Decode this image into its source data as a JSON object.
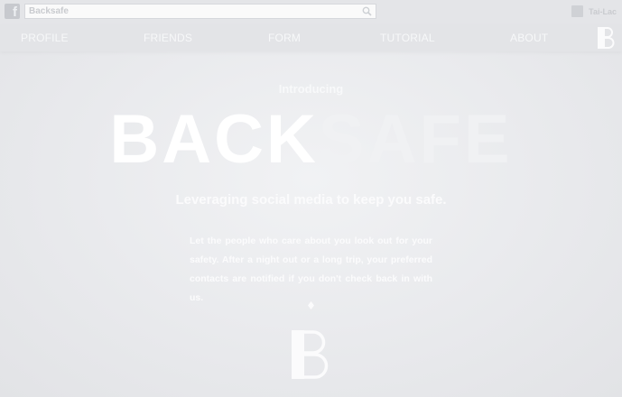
{
  "topbar": {
    "search_value": "Backsafe",
    "user_name": "Tai-Lac"
  },
  "nav": {
    "items": [
      {
        "label": "PROFILE"
      },
      {
        "label": "FRIENDS"
      },
      {
        "label": "FORM"
      },
      {
        "label": "TUTORIAL"
      },
      {
        "label": "ABOUT"
      }
    ]
  },
  "hero": {
    "intro": "Introducing",
    "title_part1": "BACK",
    "title_part2": "SAFE",
    "tagline": "Leveraging social media to keep you safe.",
    "description": "Let the people who care about you look out for your safety. After a night out or a long trip, your preferred contacts are notified if you don't check back in with us."
  },
  "colors": {
    "background": "#e8e9ec",
    "text": "#ffffff"
  }
}
